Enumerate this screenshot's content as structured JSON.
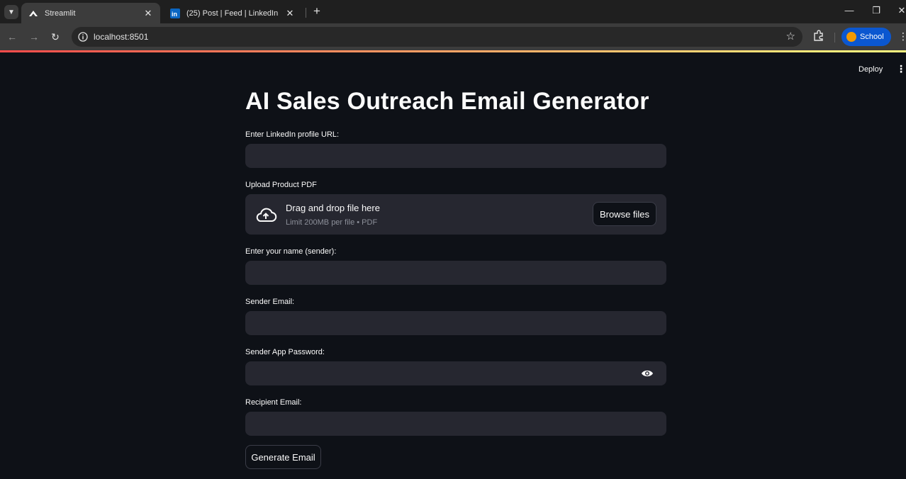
{
  "browser": {
    "tabs": [
      {
        "title": "Streamlit",
        "active": true,
        "favicon": "streamlit-icon"
      },
      {
        "title": "(25) Post | Feed | LinkedIn",
        "active": false,
        "favicon": "linkedin-icon"
      }
    ],
    "url": "localhost:8501",
    "profile_label": "School"
  },
  "app_header": {
    "deploy_label": "Deploy"
  },
  "page": {
    "title": "AI Sales Outreach Email Generator"
  },
  "form": {
    "linkedin": {
      "label": "Enter LinkedIn profile URL:",
      "value": ""
    },
    "upload": {
      "label": "Upload Product PDF",
      "drag_text": "Drag and drop file here",
      "limit_text": "Limit 200MB per file • PDF",
      "browse_label": "Browse files"
    },
    "sender_name": {
      "label": "Enter your name (sender):",
      "value": ""
    },
    "sender_email": {
      "label": "Sender Email:",
      "value": ""
    },
    "sender_password": {
      "label": "Sender App Password:",
      "value": ""
    },
    "recipient_email": {
      "label": "Recipient Email:",
      "value": ""
    },
    "generate_label": "Generate Email"
  },
  "colors": {
    "background": "#0e1117",
    "input_background": "#262730",
    "accent": "#ff4b4b",
    "profile_chip": "#0b57d0"
  }
}
